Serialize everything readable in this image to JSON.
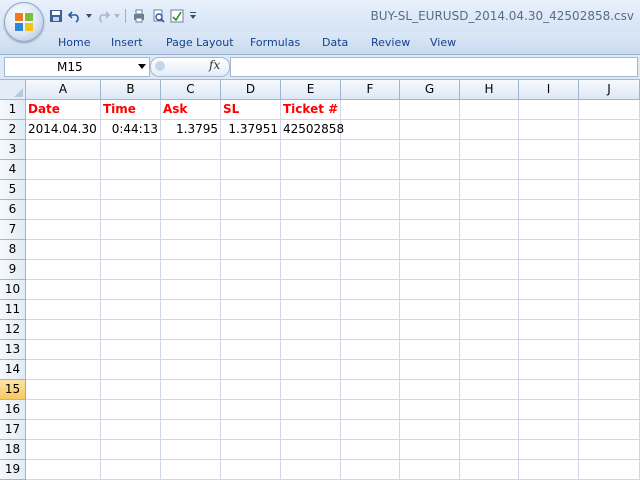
{
  "window": {
    "title": "BUY-SL_EURUSD_2014.04.30_42502858.csv"
  },
  "quick_access": {
    "icons": [
      "save-icon",
      "undo-icon",
      "redo-icon",
      "print-preview-icon",
      "print-icon",
      "spelling-icon",
      "customize-qat-icon"
    ]
  },
  "ribbon": {
    "tabs": [
      "Home",
      "Insert",
      "Page Layout",
      "Formulas",
      "Data",
      "Review",
      "View"
    ]
  },
  "formula_bar": {
    "name_box": "M15",
    "fx_label": "fx",
    "formula": ""
  },
  "sheet": {
    "columns": [
      "A",
      "B",
      "C",
      "D",
      "E",
      "F",
      "G",
      "H",
      "I",
      "J"
    ],
    "rows": [
      "1",
      "2",
      "3",
      "4",
      "5",
      "6",
      "7",
      "8",
      "9",
      "10",
      "11",
      "12",
      "13",
      "14",
      "15",
      "16",
      "17",
      "18",
      "19"
    ],
    "active_row": "15",
    "header_row": [
      "Date",
      "Time",
      "Ask",
      "SL",
      "Ticket #"
    ],
    "data_row": [
      "2014.04.30",
      "0:44:13",
      "1.3795",
      "1.37951",
      "42502858"
    ],
    "header_color": "#ff0000"
  },
  "colors": {
    "ribbon_text": "#15428b",
    "grid_line": "#d0d7e5",
    "active_row_highlight": "#f8c95f"
  }
}
